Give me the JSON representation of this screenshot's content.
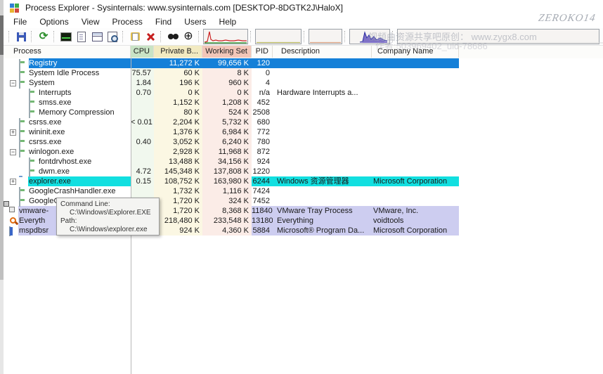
{
  "window": {
    "title": "Process Explorer - Sysinternals: www.sysinternals.com [DESKTOP-8DGTK2J\\HaloX]",
    "watermark_script": "ZEROKO14",
    "watermark_cn1": "视频由资源共享吧原创： www.zygx8.com",
    "watermark_cn2": "作者:503969402_uid-78686"
  },
  "menu": {
    "items": [
      "File",
      "Options",
      "View",
      "Process",
      "Find",
      "Users",
      "Help"
    ]
  },
  "toolbar": {
    "buttons": [
      {
        "name": "save",
        "sep_before": true
      },
      {
        "name": "refresh",
        "sep_before": true
      },
      {
        "name": "system-information",
        "sep_before": true
      },
      {
        "name": "show-handles",
        "sep_before": false
      },
      {
        "name": "show-lower-pane",
        "sep_before": false
      },
      {
        "name": "view-dlls",
        "sep_before": false
      },
      {
        "name": "properties",
        "sep_before": true
      },
      {
        "name": "kill-process",
        "sep_before": false
      },
      {
        "name": "find-handle",
        "sep_before": true
      },
      {
        "name": "find-window-process",
        "sep_before": false
      }
    ],
    "graphs": [
      "cpu-usage-graph",
      "commit-graph",
      "physical-memory-graph",
      "io-graph",
      "gpu-graph"
    ]
  },
  "columns": [
    {
      "key": "name",
      "label": "Process"
    },
    {
      "key": "cpu",
      "label": "CPU"
    },
    {
      "key": "priv",
      "label": "Private B..."
    },
    {
      "key": "ws",
      "label": "Working Set"
    },
    {
      "key": "pid",
      "label": "PID"
    },
    {
      "key": "desc",
      "label": "Description"
    },
    {
      "key": "company",
      "label": "Company Name"
    }
  ],
  "colors": {
    "selection": "#1580d8",
    "cyan_highlight": "#12dfe0",
    "lavender_highlight": "#cdcdf0",
    "cpu_header": "#c9e3c5",
    "priv_header": "#f2eac1",
    "ws_header": "#f2c6b8",
    "cpu_tint": "#f1f8ee",
    "priv_tint": "#fbf7e3",
    "ws_tint": "#fbece7"
  },
  "rows": [
    {
      "name": "Registry",
      "cpu": "",
      "priv": "11,272 K",
      "ws": "99,656 K",
      "pid": "120",
      "desc": "",
      "company": "",
      "indent": 1,
      "expander": "",
      "icon": "generic",
      "highlight": "selected"
    },
    {
      "name": "System Idle Process",
      "cpu": "75.57",
      "priv": "60 K",
      "ws": "8 K",
      "pid": "0",
      "desc": "",
      "company": "",
      "indent": 1,
      "expander": "",
      "icon": "generic",
      "highlight": ""
    },
    {
      "name": "System",
      "cpu": "1.84",
      "priv": "196 K",
      "ws": "960 K",
      "pid": "4",
      "desc": "",
      "company": "",
      "indent": 1,
      "expander": "minus",
      "icon": "generic",
      "highlight": ""
    },
    {
      "name": "Interrupts",
      "cpu": "0.70",
      "priv": "0 K",
      "ws": "0 K",
      "pid": "n/a",
      "desc": "Hardware Interrupts a...",
      "company": "",
      "indent": 2,
      "expander": "",
      "icon": "generic",
      "highlight": ""
    },
    {
      "name": "smss.exe",
      "cpu": "",
      "priv": "1,152 K",
      "ws": "1,208 K",
      "pid": "452",
      "desc": "",
      "company": "",
      "indent": 2,
      "expander": "",
      "icon": "generic",
      "highlight": ""
    },
    {
      "name": "Memory Compression",
      "cpu": "",
      "priv": "80 K",
      "ws": "524 K",
      "pid": "2508",
      "desc": "",
      "company": "",
      "indent": 2,
      "expander": "",
      "icon": "generic",
      "highlight": ""
    },
    {
      "name": "csrss.exe",
      "cpu": "< 0.01",
      "priv": "2,204 K",
      "ws": "5,732 K",
      "pid": "680",
      "desc": "",
      "company": "",
      "indent": 1,
      "expander": "",
      "icon": "generic",
      "highlight": ""
    },
    {
      "name": "wininit.exe",
      "cpu": "",
      "priv": "1,376 K",
      "ws": "6,984 K",
      "pid": "772",
      "desc": "",
      "company": "",
      "indent": 1,
      "expander": "plus",
      "icon": "generic",
      "highlight": ""
    },
    {
      "name": "csrss.exe",
      "cpu": "0.40",
      "priv": "3,052 K",
      "ws": "6,240 K",
      "pid": "780",
      "desc": "",
      "company": "",
      "indent": 1,
      "expander": "",
      "icon": "generic",
      "highlight": ""
    },
    {
      "name": "winlogon.exe",
      "cpu": "",
      "priv": "2,928 K",
      "ws": "11,968 K",
      "pid": "872",
      "desc": "",
      "company": "",
      "indent": 1,
      "expander": "minus",
      "icon": "generic",
      "highlight": ""
    },
    {
      "name": "fontdrvhost.exe",
      "cpu": "",
      "priv": "13,488 K",
      "ws": "34,156 K",
      "pid": "924",
      "desc": "",
      "company": "",
      "indent": 2,
      "expander": "",
      "icon": "generic",
      "highlight": ""
    },
    {
      "name": "dwm.exe",
      "cpu": "4.72",
      "priv": "145,348 K",
      "ws": "137,808 K",
      "pid": "1220",
      "desc": "",
      "company": "",
      "indent": 2,
      "expander": "",
      "icon": "generic",
      "highlight": ""
    },
    {
      "name": "explorer.exe",
      "cpu": "0.15",
      "priv": "108,752 K",
      "ws": "163,980 K",
      "pid": "6244",
      "desc": "Windows 资源管理器",
      "company": "Microsoft Corporation",
      "indent": 1,
      "expander": "plus",
      "icon": "folder",
      "highlight": "cyan"
    },
    {
      "name": "GoogleCrashHandler.exe",
      "cpu": "",
      "priv": "1,732 K",
      "ws": "1,116 K",
      "pid": "7424",
      "desc": "",
      "company": "",
      "indent": 1,
      "expander": "",
      "icon": "generic",
      "highlight": ""
    },
    {
      "name": "GoogleC",
      "cpu": "",
      "priv": "1,720 K",
      "ws": "324 K",
      "pid": "7452",
      "desc": "",
      "company": "",
      "indent": 1,
      "expander": "",
      "icon": "generic",
      "highlight": ""
    },
    {
      "name": "vmware-",
      "cpu": "",
      "priv": "1,720 K",
      "ws": "8,368 K",
      "pid": "11840",
      "desc": "VMware Tray Process",
      "company": "VMware, Inc.",
      "indent": 0,
      "expander": "",
      "icon": "vmware",
      "highlight": "lavender"
    },
    {
      "name": "Everyth",
      "cpu": "",
      "priv": "218,480 K",
      "ws": "233,548 K",
      "pid": "13180",
      "desc": "Everything",
      "company": "voidtools",
      "indent": 0,
      "expander": "",
      "icon": "everything",
      "highlight": "lavender"
    },
    {
      "name": "mspdbsr",
      "cpu": "",
      "priv": "924 K",
      "ws": "4,360 K",
      "pid": "5884",
      "desc": "Microsoft® Program Da...",
      "company": "Microsoft Corporation",
      "indent": 0,
      "expander": "",
      "icon": "mspdb",
      "highlight": "lavender"
    }
  ],
  "tooltip": {
    "lines": [
      {
        "text": "Command Line:",
        "indent": false
      },
      {
        "text": "C:\\Windows\\Explorer.EXE",
        "indent": true
      },
      {
        "text": "Path:",
        "indent": false
      },
      {
        "text": "C:\\Windows\\explorer.exe",
        "indent": true
      }
    ]
  }
}
